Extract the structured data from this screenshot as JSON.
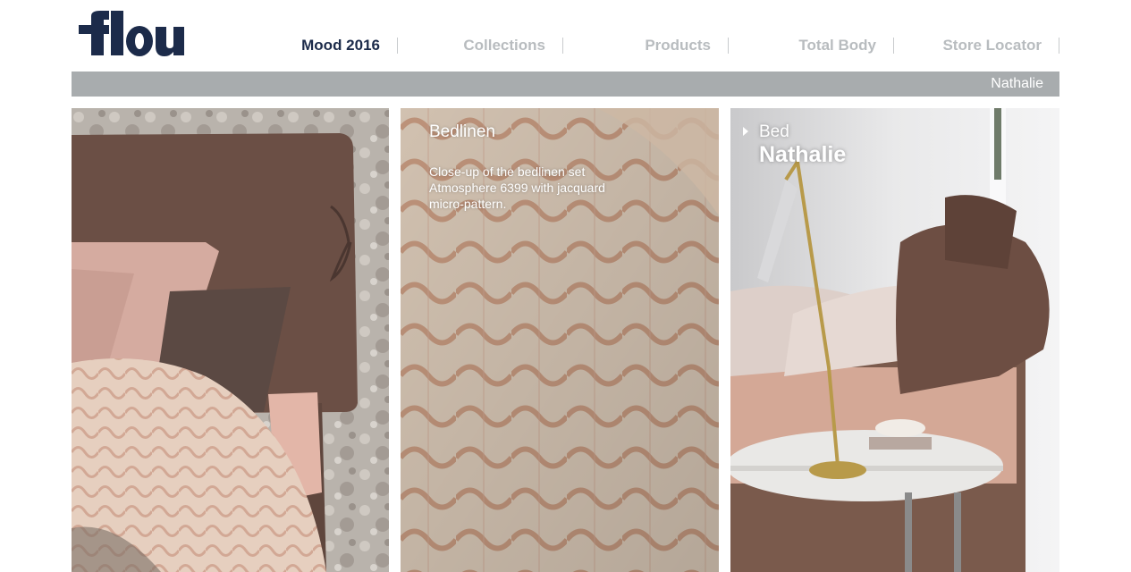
{
  "brand": {
    "logo_text": "flou",
    "logo_color": "#1c2b4a"
  },
  "nav": {
    "items": [
      {
        "label": "Mood 2016",
        "active": true
      },
      {
        "label": "Collections",
        "active": false
      },
      {
        "label": "Products",
        "active": false
      },
      {
        "label": "Total Body",
        "active": false
      },
      {
        "label": "Store Locator",
        "active": false
      }
    ]
  },
  "breadcrumb": {
    "current": "Nathalie"
  },
  "panels": {
    "bedlinen": {
      "title": "Bedlinen",
      "description": "Close-up of the bedlinen set Atmosphere 6399 with jacquard micro-pattern."
    },
    "bed": {
      "category": "Bed",
      "name": "Nathalie"
    }
  },
  "colors": {
    "nav_active": "#1c2b4a",
    "nav_inactive": "#b8bcbf",
    "breadcrumb_bg": "#a8acae"
  }
}
